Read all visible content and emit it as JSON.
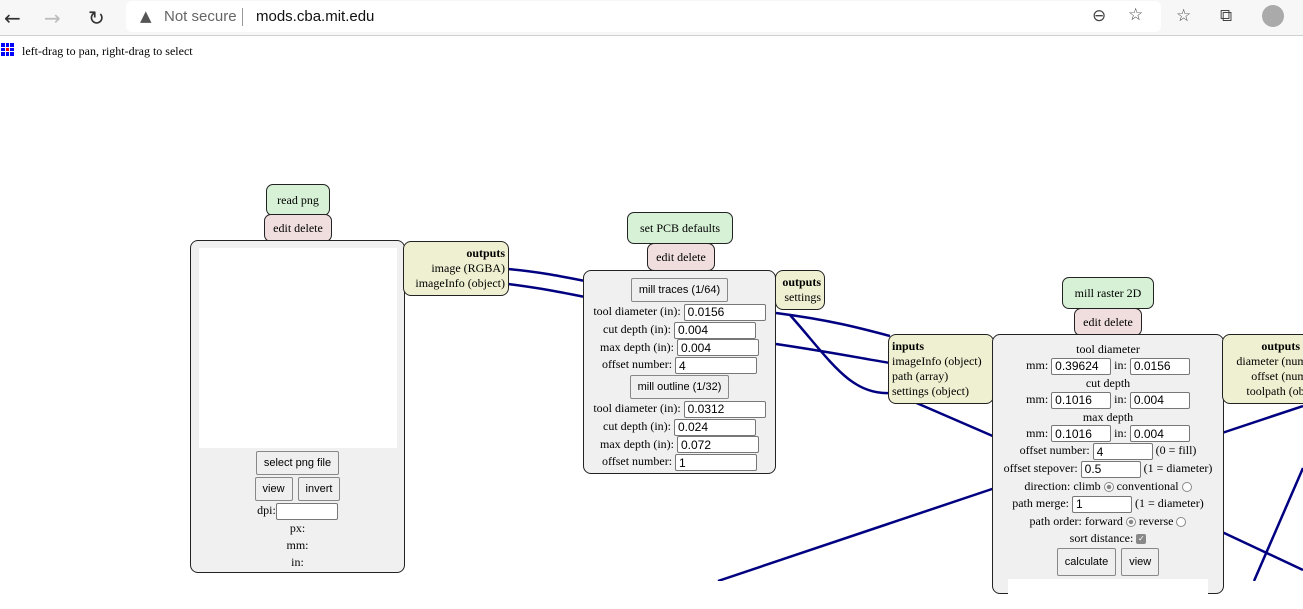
{
  "browser": {
    "url": "mods.cba.mit.edu",
    "security": "Not secure",
    "icons": [
      "back-icon",
      "forward-icon",
      "reload-icon",
      "warning-icon",
      "zoom-out-icon",
      "add-favorite-icon",
      "favorites-icon",
      "collections-icon",
      "profile-icon"
    ]
  },
  "hint": "left-drag to pan, right-drag to select",
  "wire_color": "#000080",
  "read_png": {
    "title": "read png",
    "edit": "edit delete",
    "outputs_label": "outputs",
    "outputs": [
      "image (RGBA)",
      "imageInfo (object)"
    ],
    "select": "select png file",
    "view": "view",
    "invert": "invert",
    "dpi_label": "dpi:",
    "dpi": "",
    "px": "px:",
    "mm": "mm:",
    "in": "in:"
  },
  "pcb": {
    "title": "set PCB defaults",
    "edit": "edit delete",
    "outputs_label": "outputs",
    "outputs": [
      "settings"
    ],
    "traces": {
      "button": "mill traces (1/64)",
      "tool_label": "tool diameter (in):",
      "tool": "0.0156",
      "cut_label": "cut depth (in):",
      "cut": "0.004",
      "max_label": "max depth (in):",
      "max": "0.004",
      "offset_label": "offset number:",
      "offset": "4"
    },
    "outline": {
      "button": "mill outline (1/32)",
      "tool_label": "tool diameter (in):",
      "tool": "0.0312",
      "cut_label": "cut depth (in):",
      "cut": "0.024",
      "max_label": "max depth (in):",
      "max": "0.072",
      "offset_label": "offset number:",
      "offset": "1"
    }
  },
  "raster": {
    "title": "mill raster 2D",
    "edit": "edit delete",
    "inputs_label": "inputs",
    "inputs": [
      "imageInfo (object)",
      "path (array)",
      "settings (object)"
    ],
    "outputs_label": "outputs",
    "outputs": [
      "diameter (number)",
      "offset (number)",
      "toolpath (object)"
    ],
    "tool_heading": "tool diameter",
    "cut_heading": "cut depth",
    "max_heading": "max depth",
    "mm": "mm:",
    "in": "in:",
    "tool_mm": "0.39624",
    "tool_in": "0.0156",
    "cut_mm": "0.1016",
    "cut_in": "0.004",
    "max_mm": "0.1016",
    "max_in": "0.004",
    "offset_label": "offset number:",
    "offset": "4",
    "offset_note": "(0 = fill)",
    "stepover_label": "offset stepover:",
    "stepover": "0.5",
    "stepover_note": "(1 = diameter)",
    "direction_label": "direction: climb",
    "conventional": "conventional",
    "direction": "climb",
    "merge_label": "path merge:",
    "merge": "1",
    "merge_note": "(1 = diameter)",
    "order_label": "path order: forward",
    "reverse": "reverse",
    "order": "forward",
    "sort_label": "sort distance:",
    "sort": true,
    "calculate": "calculate",
    "view": "view"
  }
}
